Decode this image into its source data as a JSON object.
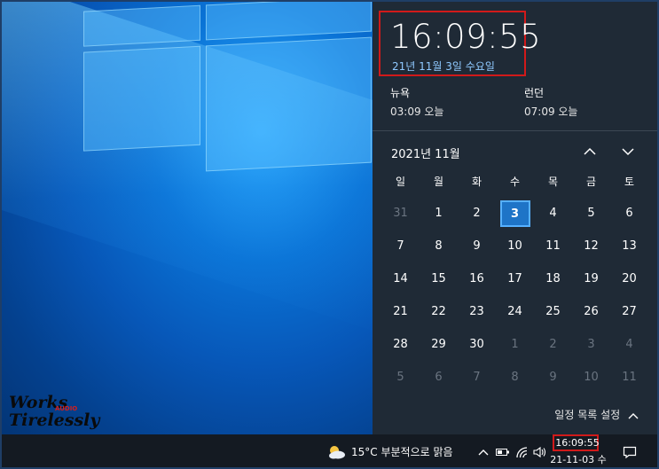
{
  "clock": {
    "time": "16:09:55",
    "date": "21년 11월 3일 수요일"
  },
  "world_clocks": [
    {
      "city": "뉴욕",
      "time": "03:09 오늘"
    },
    {
      "city": "런던",
      "time": "07:09 오늘"
    }
  ],
  "calendar": {
    "month_label": "2021년 11월",
    "weekdays": [
      "일",
      "월",
      "화",
      "수",
      "목",
      "금",
      "토"
    ],
    "weeks": [
      [
        "31",
        "1",
        "2",
        "3",
        "4",
        "5",
        "6"
      ],
      [
        "7",
        "8",
        "9",
        "10",
        "11",
        "12",
        "13"
      ],
      [
        "14",
        "15",
        "16",
        "17",
        "18",
        "19",
        "20"
      ],
      [
        "21",
        "22",
        "23",
        "24",
        "25",
        "26",
        "27"
      ],
      [
        "28",
        "29",
        "30",
        "1",
        "2",
        "3",
        "4"
      ],
      [
        "5",
        "6",
        "7",
        "8",
        "9",
        "10",
        "11"
      ]
    ],
    "today": "3",
    "agenda_label": "일정 목록 설정"
  },
  "taskbar": {
    "weather": "15°C  부분적으로 맑음",
    "tray_time": "16:09:55",
    "tray_date": "21-11-03 수"
  },
  "watermark": {
    "line1": "Works",
    "line2": "Tirelessly",
    "badge": "AUDIO"
  },
  "colors": {
    "panel": "#1f2a36",
    "accent": "#1e74c7",
    "highlight": "#d11a1a",
    "taskbar": "#141a22"
  }
}
